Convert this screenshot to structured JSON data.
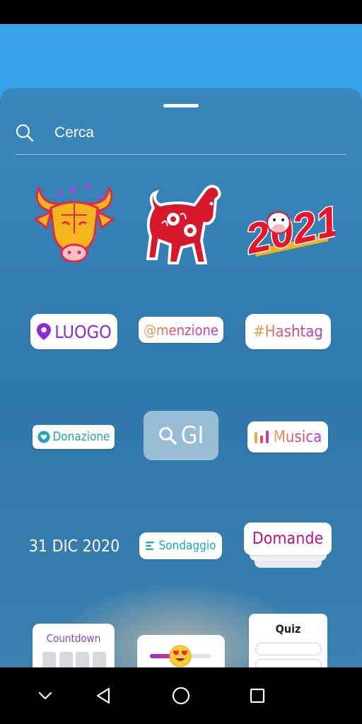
{
  "search": {
    "placeholder": "Cerca"
  },
  "stickers": {
    "location": "LUOGO",
    "mention": "@menzione",
    "hashtag": "#Hashtag",
    "donation": "Donazione",
    "gif": "GI",
    "music": "Musica",
    "date": "31 DIC 2020",
    "poll": "Sondaggio",
    "questions": "Domande",
    "countdown": "Countdown",
    "quiz": "Quiz",
    "year_sticker": "2021"
  },
  "colors": {
    "backdrop": "#37a3ea",
    "sheet": "#3281b5",
    "location_purple": "#8e2bd6",
    "donation_teal": "#1ea5b8",
    "poll_teal": "#18b0a8",
    "questions_magenta": "#c0127e",
    "countdown_purple": "#8a44c9"
  },
  "icons": {
    "search": "search-icon",
    "location": "location-pin-icon",
    "donation": "heart-icon",
    "gif": "magnifier-icon",
    "music": "equalizer-icon",
    "poll": "list-lines-icon",
    "nav_hide": "chevron-down-icon",
    "nav_back": "back-triangle-icon",
    "nav_home": "home-circle-icon",
    "nav_recents": "recents-square-icon"
  }
}
